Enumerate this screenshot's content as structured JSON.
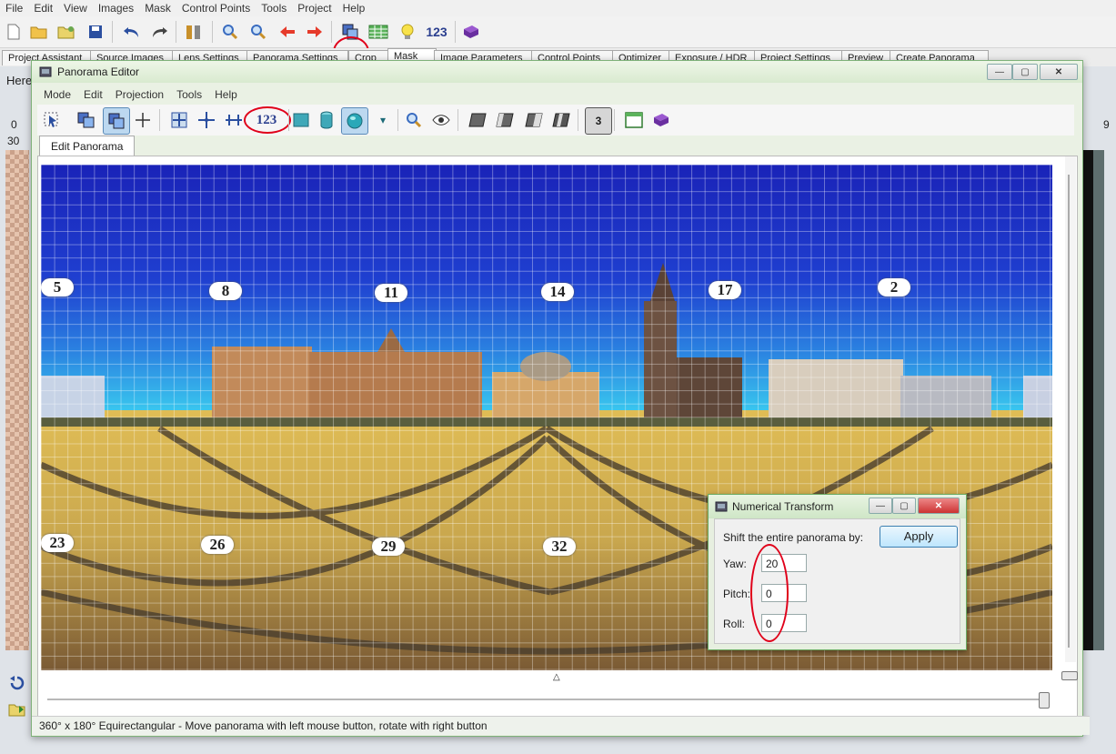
{
  "main_window": {
    "menu": [
      "File",
      "Edit",
      "View",
      "Images",
      "Mask",
      "Control Points",
      "Tools",
      "Project",
      "Help"
    ],
    "toolbar_number_label": "123",
    "tabs": [
      "Project Assistant",
      "Source Images",
      "Lens Settings",
      "Panorama Settings",
      "Crop",
      "Mask",
      "Image Parameters",
      "Control Points",
      "Optimizer",
      "Exposure / HDR",
      "Project Settings",
      "Preview",
      "Create Panorama"
    ],
    "assistant_text": "Here",
    "side_numbers": {
      "left_top": "0",
      "left_bottom": "30",
      "right_top": "9"
    }
  },
  "panorama_editor": {
    "title": "Panorama Editor",
    "menu": [
      "Mode",
      "Edit",
      "Projection",
      "Tools",
      "Help"
    ],
    "toolbar": {
      "numeric_label": "123",
      "layer_count": "3"
    },
    "tab_label": "Edit Panorama",
    "image_labels": [
      {
        "text": "5"
      },
      {
        "text": "8"
      },
      {
        "text": "11"
      },
      {
        "text": "14"
      },
      {
        "text": "17"
      },
      {
        "text": "2"
      },
      {
        "text": "23"
      },
      {
        "text": "26"
      },
      {
        "text": "29"
      },
      {
        "text": "32"
      }
    ],
    "status_text": "360° x 180° Equirectangular - Move panorama with left mouse button, rotate with right button"
  },
  "numerical_transform": {
    "title": "Numerical Transform",
    "prompt": "Shift the entire panorama by:",
    "apply_label": "Apply",
    "fields": [
      {
        "label": "Yaw:",
        "value": "20"
      },
      {
        "label": "Pitch:",
        "value": "0"
      },
      {
        "label": "Roll:",
        "value": "0"
      }
    ]
  },
  "colors": {
    "accent_red": "#e0001a",
    "editor_frame": "#7fb27a",
    "sky_top": "#1f2fc4",
    "sky_horizon": "#2fa8e8",
    "ground": "#c9a74e"
  }
}
